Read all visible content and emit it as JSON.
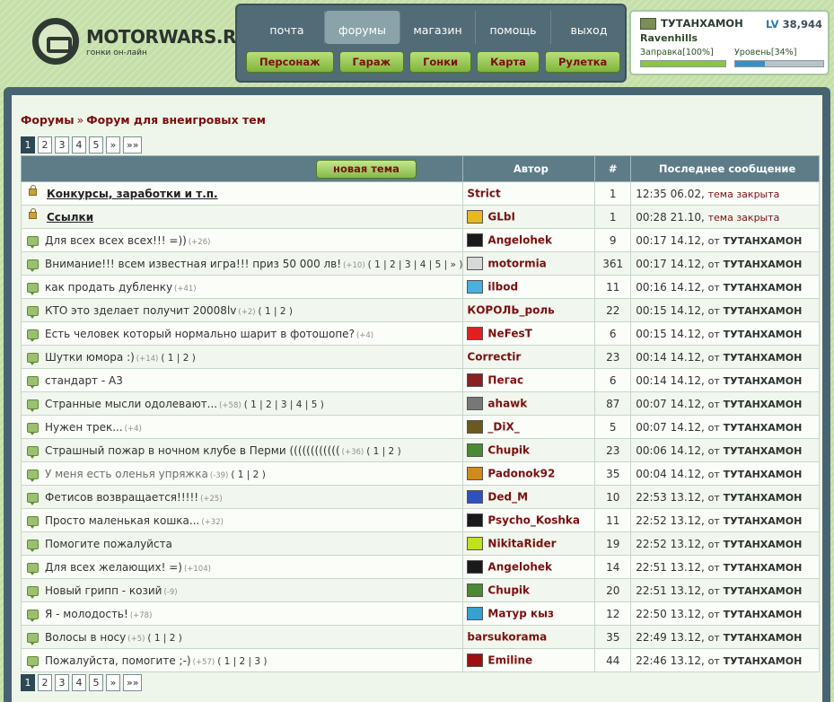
{
  "site": {
    "name": "MOTORWARS.RU",
    "tagline": "гонки он-лайн"
  },
  "top_nav": [
    {
      "label": "почта",
      "active": false
    },
    {
      "label": "форумы",
      "active": true
    },
    {
      "label": "магазин",
      "active": false
    },
    {
      "label": "помощь",
      "active": false
    },
    {
      "label": "выход",
      "active": false
    }
  ],
  "sub_nav": [
    "Персонаж",
    "Гараж",
    "Гонки",
    "Карта",
    "Рулетка"
  ],
  "user": {
    "name": "ТУТАНХАМОН",
    "level_prefix": "LV",
    "level": "38,944",
    "city": "Ravenhills",
    "fuel_label": "Заправка[100%]",
    "fuel_fraction": 1.0,
    "level_progress_label": "Уровень[34%]",
    "level_progress_fraction": 0.34,
    "colors": {
      "fuel": "#8cc63f",
      "level": "#3a8fc4"
    }
  },
  "breadcrumb": {
    "root": "Форумы",
    "separator": "»",
    "current": "Форум для внеигровых тем"
  },
  "pager": {
    "pages": [
      "1",
      "2",
      "3",
      "4",
      "5",
      "»",
      "»»"
    ],
    "current": "1"
  },
  "table": {
    "new_topic_label": "новая тема",
    "headers": {
      "author": "Автор",
      "count": "#",
      "last": "Последнее сообщение"
    },
    "from_label": "от",
    "rows": [
      {
        "icon": "lock",
        "title": "Конкурсы, заработки и т.п.",
        "style": "closed",
        "extra": "",
        "pages": "",
        "author": "Strict",
        "avatar": "",
        "count": "1",
        "time": "12:35 06.02,",
        "status": "тема закрыта",
        "by": ""
      },
      {
        "icon": "lock",
        "title": "Ссылки",
        "style": "closed",
        "extra": "",
        "pages": "",
        "author": "GLbI",
        "avatar": "#e8b820",
        "count": "1",
        "time": "00:28 21.10,",
        "status": "тема закрыта",
        "by": ""
      },
      {
        "icon": "msg",
        "title": "Для всех всех всех!!! =))",
        "style": "",
        "extra": "(+26)",
        "pages": "",
        "author": "Angelohek",
        "avatar": "#1a1a1a",
        "count": "9",
        "time": "00:17 14.12,",
        "status": "",
        "by": "ТУТАНХАМОН"
      },
      {
        "icon": "msg",
        "title": "Внимание!!! всем известная игра!!! приз 50 000 лв!",
        "style": "",
        "extra": "(+10)",
        "pages": "( 1 | 2 | 3 | 4 | 5 | » )",
        "author": "motormia",
        "avatar": "#d8d8d8",
        "count": "361",
        "time": "00:17 14.12,",
        "status": "",
        "by": "ТУТАНХАМОН"
      },
      {
        "icon": "msg",
        "title": "как продать дубленку",
        "style": "",
        "extra": "(+41)",
        "pages": "",
        "author": "ilbod",
        "avatar": "#4ab0e0",
        "count": "11",
        "time": "00:16 14.12,",
        "status": "",
        "by": "ТУТАНХАМОН"
      },
      {
        "icon": "msg",
        "title": "КТО это зделает получит 20008lv",
        "style": "",
        "extra": "(+2)",
        "pages": "( 1 | 2 )",
        "author": "КОРОЛЬ_роль",
        "avatar": "",
        "count": "22",
        "time": "00:15 14.12,",
        "status": "",
        "by": "ТУТАНХАМОН"
      },
      {
        "icon": "msg",
        "title": "Есть человек который нормально шарит в фотошопе?",
        "style": "",
        "extra": "(+4)",
        "pages": "",
        "author": "NeFesT",
        "avatar": "#e02020",
        "count": "6",
        "time": "00:15 14.12,",
        "status": "",
        "by": "ТУТАНХАМОН"
      },
      {
        "icon": "msg",
        "title": "Шутки юмора :)",
        "style": "",
        "extra": "(+14)",
        "pages": "( 1 | 2 )",
        "author": "Correctir",
        "avatar": "",
        "count": "23",
        "time": "00:14 14.12,",
        "status": "",
        "by": "ТУТАНХАМОН"
      },
      {
        "icon": "msg",
        "title": "стандарт - А3",
        "style": "",
        "extra": "",
        "pages": "",
        "author": "Пегас",
        "avatar": "#8a2020",
        "count": "6",
        "time": "00:14 14.12,",
        "status": "",
        "by": "ТУТАНХАМОН"
      },
      {
        "icon": "msg",
        "title": "Странные мысли одолевают...",
        "style": "",
        "extra": "(+58)",
        "pages": "( 1 | 2 | 3 | 4 | 5 )",
        "author": "ahawk",
        "avatar": "#777777",
        "count": "87",
        "time": "00:07 14.12,",
        "status": "",
        "by": "ТУТАНХАМОН"
      },
      {
        "icon": "msg",
        "title": "Нужен трек...",
        "style": "",
        "extra": "(+4)",
        "pages": "",
        "author": "_DiX_",
        "avatar": "#6a5a20",
        "count": "5",
        "time": "00:07 14.12,",
        "status": "",
        "by": "ТУТАНХАМОН"
      },
      {
        "icon": "msg",
        "title": "Страшный пожар в ночном клубе в Перми ((((((((((((",
        "style": "",
        "extra": "(+36)",
        "pages": "( 1 | 2 )",
        "author": "Chupik",
        "avatar": "#4a8a30",
        "count": "23",
        "time": "00:06 14.12,",
        "status": "",
        "by": "ТУТАНХАМОН"
      },
      {
        "icon": "msg",
        "title": "У меня есть оленья упряжка",
        "style": "dim",
        "extra": "(-39)",
        "pages": "( 1 | 2 )",
        "author": "Padonok92",
        "avatar": "#d08a20",
        "count": "35",
        "time": "00:04 14.12,",
        "status": "",
        "by": "ТУТАНХАМОН"
      },
      {
        "icon": "msg",
        "title": "Фетисов возвращается!!!!!",
        "style": "",
        "extra": "(+25)",
        "pages": "",
        "author": "Ded_M",
        "avatar": "#3050c0",
        "count": "10",
        "time": "22:53 13.12,",
        "status": "",
        "by": "ТУТАНХАМОН"
      },
      {
        "icon": "msg",
        "title": "Просто маленькая кошка...",
        "style": "",
        "extra": "(+32)",
        "pages": "",
        "author": "Psycho_Koshka",
        "avatar": "#1a1a1a",
        "count": "11",
        "time": "22:52 13.12,",
        "status": "",
        "by": "ТУТАНХАМОН"
      },
      {
        "icon": "msg",
        "title": "Помогите пожалуйста",
        "style": "",
        "extra": "",
        "pages": "",
        "author": "NikitaRider",
        "avatar": "#c0e020",
        "count": "19",
        "time": "22:52 13.12,",
        "status": "",
        "by": "ТУТАНХАМОН"
      },
      {
        "icon": "msg",
        "title": "Для всех желающих! =)",
        "style": "",
        "extra": "(+104)",
        "pages": "",
        "author": "Angelohek",
        "avatar": "#1a1a1a",
        "count": "14",
        "time": "22:51 13.12,",
        "status": "",
        "by": "ТУТАНХАМОН"
      },
      {
        "icon": "msg",
        "title": "Новый грипп - козий",
        "style": "",
        "extra": "(-9)",
        "pages": "",
        "author": "Chupik",
        "avatar": "#4a8a30",
        "count": "20",
        "time": "22:51 13.12,",
        "status": "",
        "by": "ТУТАНХАМОН"
      },
      {
        "icon": "msg",
        "title": "Я - молодость!",
        "style": "",
        "extra": "(+78)",
        "pages": "",
        "author": "Матур кыз",
        "avatar": "#3aa0d0",
        "count": "12",
        "time": "22:50 13.12,",
        "status": "",
        "by": "ТУТАНХАМОН"
      },
      {
        "icon": "msg",
        "title": "Волосы в носу",
        "style": "",
        "extra": "(+5)",
        "pages": "( 1 | 2 )",
        "author": "barsukorama",
        "avatar": "",
        "count": "35",
        "time": "22:49 13.12,",
        "status": "",
        "by": "ТУТАНХАМОН"
      },
      {
        "icon": "msg",
        "title": "Пожалуйста, помогите ;-)",
        "style": "",
        "extra": "(+57)",
        "pages": "( 1 | 2 | 3 )",
        "author": "Emiline",
        "avatar": "#a01010",
        "count": "44",
        "time": "22:46 13.12,",
        "status": "",
        "by": "ТУТАНХАМОН"
      }
    ]
  }
}
